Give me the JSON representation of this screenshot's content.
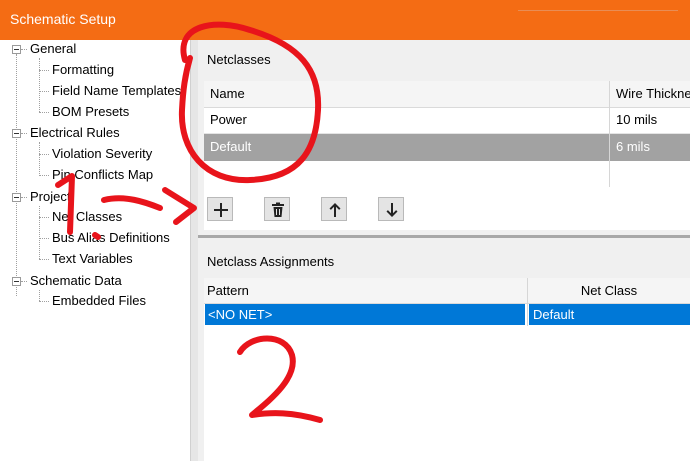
{
  "window": {
    "title": "Schematic Setup"
  },
  "tree": {
    "items": [
      {
        "label": "General",
        "level": 0
      },
      {
        "label": "Formatting",
        "level": 1
      },
      {
        "label": "Field Name Templates",
        "level": 1
      },
      {
        "label": "BOM Presets",
        "level": 1
      },
      {
        "label": "Electrical Rules",
        "level": 0
      },
      {
        "label": "Violation Severity",
        "level": 1
      },
      {
        "label": "Pin Conflicts Map",
        "level": 1
      },
      {
        "label": "Project",
        "level": 0
      },
      {
        "label": "Net Classes",
        "level": 1
      },
      {
        "label": "Bus Alias Definitions",
        "level": 1
      },
      {
        "label": "Text Variables",
        "level": 1
      },
      {
        "label": "Schematic Data",
        "level": 0
      },
      {
        "label": "Embedded Files",
        "level": 1
      }
    ]
  },
  "netclasses": {
    "section_title": "Netclasses",
    "columns": [
      "Name",
      "Wire Thickness"
    ],
    "rows": [
      {
        "name": "Power",
        "wire": "10 mils",
        "selected": false
      },
      {
        "name": "Default",
        "wire": "6 mils",
        "selected": true
      }
    ],
    "toolbar": {
      "add_icon": "plus-icon",
      "delete_icon": "trash-icon",
      "up_icon": "arrow-up-icon",
      "down_icon": "arrow-down-icon"
    }
  },
  "assignments": {
    "section_title": "Netclass Assignments",
    "columns": [
      "Pattern",
      "Net Class"
    ],
    "rows": [
      {
        "pattern": "<NO NET>",
        "net_class": "Default",
        "selected": true
      }
    ]
  },
  "annotations": {
    "step1": "1.",
    "step2": "2"
  },
  "colors": {
    "titlebar": "#f46c14",
    "selection_blue": "#0078d7",
    "selection_gray": "#a2a2a2",
    "annotation_red": "#e8141b"
  }
}
